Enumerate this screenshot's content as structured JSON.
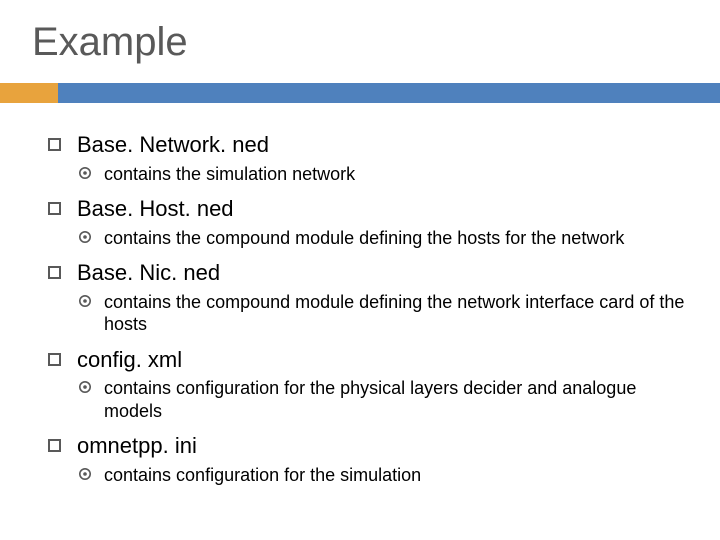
{
  "title": "Example",
  "accent": {
    "orange": "#e8a33d",
    "blue": "#4f81bd",
    "gray": "#595959"
  },
  "items": [
    {
      "label": "Base. Network. ned",
      "sub": "contains the simulation network"
    },
    {
      "label": "Base. Host. ned",
      "sub": "contains the compound module defining the hosts for the network"
    },
    {
      "label": "Base. Nic. ned",
      "sub": "contains the compound module defining the network interface card of the hosts"
    },
    {
      "label": "config. xml",
      "sub": "contains configuration for the physical layers decider and analogue models"
    },
    {
      "label": "omnetpp. ini",
      "sub": "contains configuration for the simulation"
    }
  ]
}
